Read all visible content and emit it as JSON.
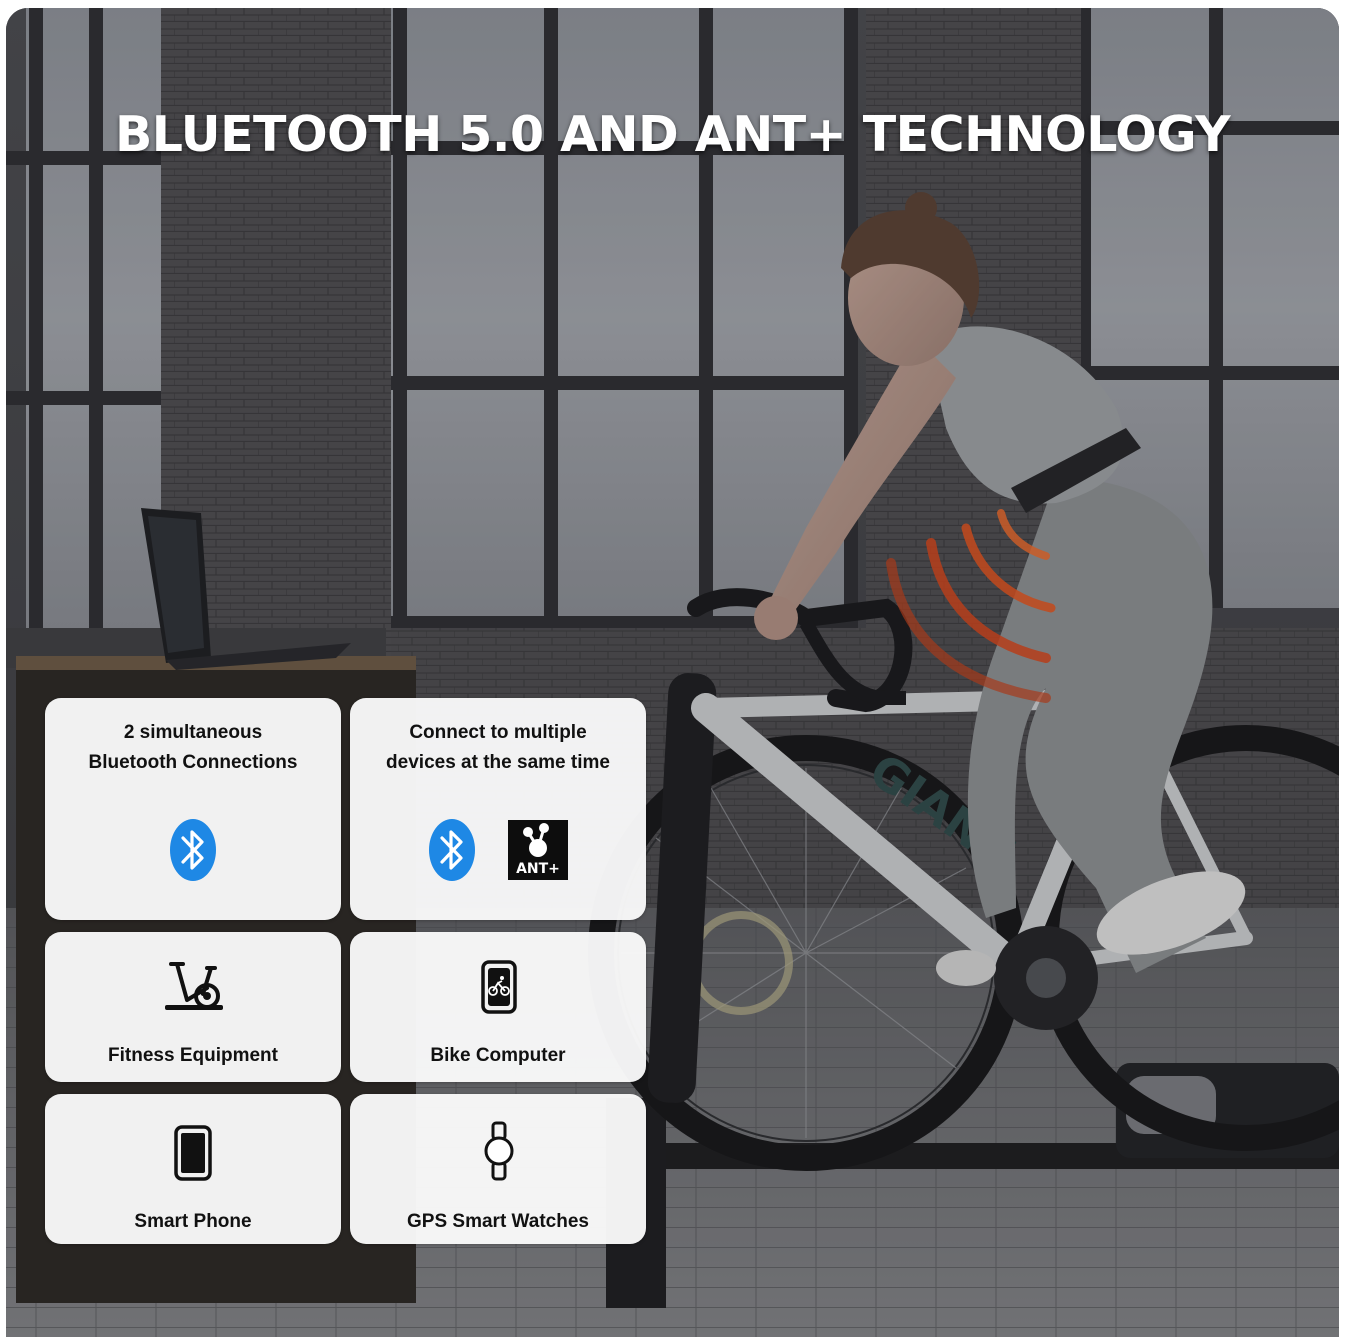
{
  "headline": "BLUETOOTH 5.0 AND ANT+ TECHNOLOGY",
  "colors": {
    "bluetooth_blue": "#1e88e5",
    "signal_orange": "#e8501c",
    "card_background": "#fafafa"
  },
  "features": {
    "bluetooth_connections": {
      "line1": "2 simultaneous",
      "line2": "Bluetooth Connections",
      "icon": "bluetooth-icon"
    },
    "multi_device": {
      "line1": "Connect to multiple",
      "line2": "devices at the same time",
      "icons": [
        "bluetooth-icon",
        "ant-plus-icon"
      ],
      "ant_label": "ANT+"
    },
    "fitness_equipment": {
      "label": "Fitness Equipment",
      "icon": "exercise-bike-icon"
    },
    "bike_computer": {
      "label": "Bike Computer",
      "icon": "bike-computer-icon"
    },
    "smart_phone": {
      "label": "Smart Phone",
      "icon": "smartphone-icon"
    },
    "gps_watches": {
      "label": "GPS Smart Watches",
      "icon": "smartwatch-icon"
    }
  },
  "background_photo": "woman riding road bike on indoor smart trainer in loft with large windows"
}
